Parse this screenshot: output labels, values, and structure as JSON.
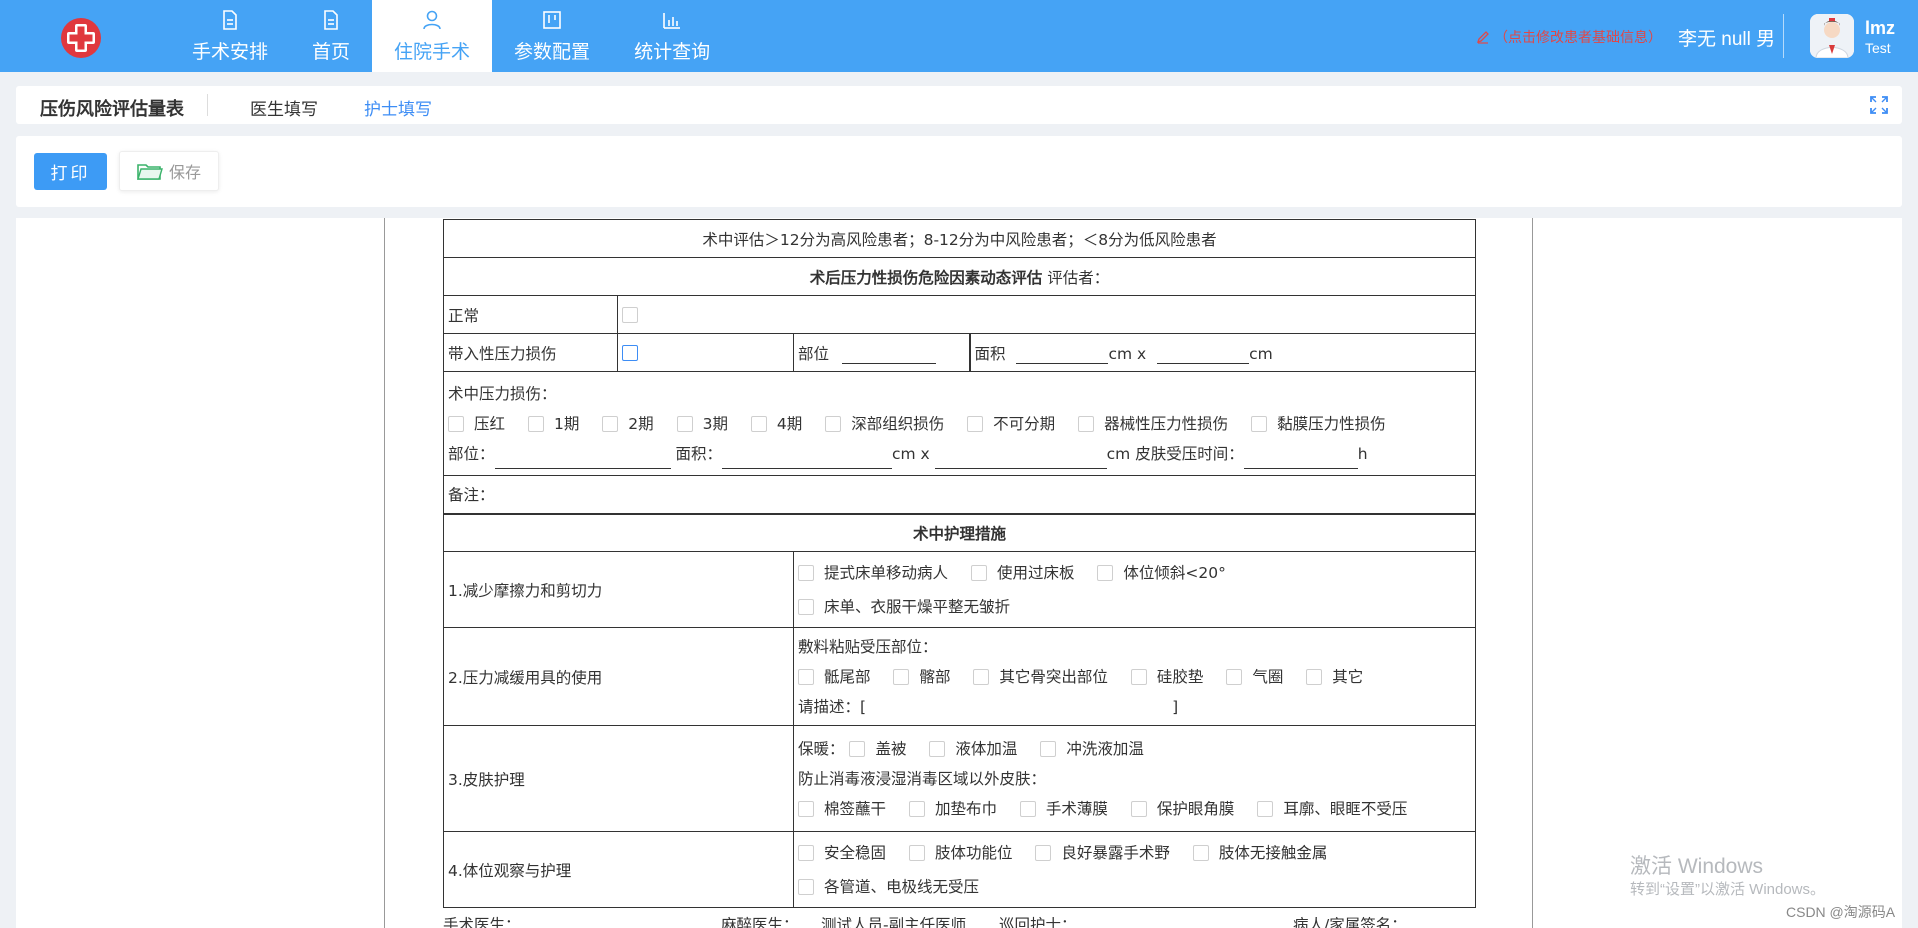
{
  "nav": {
    "items": [
      {
        "label": "手术安排",
        "icon": "document-icon"
      },
      {
        "label": "首页",
        "icon": "document-icon"
      },
      {
        "label": "住院手术",
        "icon": "user-icon",
        "active": true
      },
      {
        "label": "参数配置",
        "icon": "board-icon"
      },
      {
        "label": "统计查询",
        "icon": "bar-chart-icon"
      }
    ]
  },
  "header": {
    "edit_hint": "（点击修改患者基础信息）",
    "patient": "李无 null 男",
    "user_name": "lmz",
    "user_role": "Test"
  },
  "tabs": {
    "title": "压伤风险评估量表",
    "doctor": "医生填写",
    "nurse": "护士填写"
  },
  "toolbar": {
    "print": "打印",
    "save": "保存"
  },
  "form": {
    "risk_note": "术中评估＞12分为高风险患者；8-12分为中风险患者；＜8分为低风险患者",
    "post_title": "术后压力性损伤危险因素动态评估",
    "assessor_label": "评估者：",
    "normal": "正常",
    "carried_injury": "带入性压力损伤",
    "site": "部位",
    "area": "面积",
    "cm_x": "cm x",
    "cm": "cm",
    "intra_injury_label": "术中压力损伤：",
    "stages": [
      "压红",
      "1期",
      "2期",
      "3期",
      "4期",
      "深部组织损伤",
      "不可分期",
      "器械性压力性损伤",
      "黏膜压力性损伤"
    ],
    "site_colon": "部位：",
    "area_colon": "面积：",
    "skin_time": "皮肤受压时间：",
    "hour": "h",
    "remark": "备注：",
    "measures_title": "术中护理措施",
    "m1_label": "1.减少摩擦力和剪切力",
    "m1_opts_row1": [
      "提式床单移动病人",
      "使用过床板",
      "体位倾斜<20°"
    ],
    "m1_opts_row2": [
      "床单、衣服干燥平整无皱折"
    ],
    "m2_label": "2.压力减缓用具的使用",
    "m2_sub": "敷料粘贴受压部位：",
    "m2_opts": [
      "骶尾部",
      "髂部",
      "其它骨突出部位",
      "硅胶垫",
      "气圈",
      "其它"
    ],
    "m2_desc": "请描述：[",
    "m2_desc_end": "]",
    "m3_label": "3.皮肤护理",
    "m3_warm": "保暖：",
    "m3_warm_opts": [
      "盖被",
      "液体加温",
      "冲洗液加温"
    ],
    "m3_sub": "防止消毒液浸湿消毒区域以外皮肤：",
    "m3_opts": [
      "棉签蘸干",
      "加垫布巾",
      "手术薄膜",
      "保护眼角膜",
      "耳廓、眼眶不受压"
    ],
    "m4_label": "4.体位观察与护理",
    "m4_opts_row1": [
      "安全稳固",
      "肢体功能位",
      "良好暴露手术野",
      "肢体无接触金属"
    ],
    "m4_opts_row2": [
      "各管道、电极线无受压"
    ]
  },
  "signature": {
    "surgeon": "手术医生：",
    "anesth": "麻醉医生：",
    "anesth_value": "测试人员-副主任医师",
    "circ_nurse": "巡回护士：",
    "family": "病人/家属签名："
  },
  "watermarks": {
    "win1": "激活 Windows",
    "win2": "转到“设置”以激活 Windows。",
    "csdn": "CSDN @淘源码A"
  }
}
